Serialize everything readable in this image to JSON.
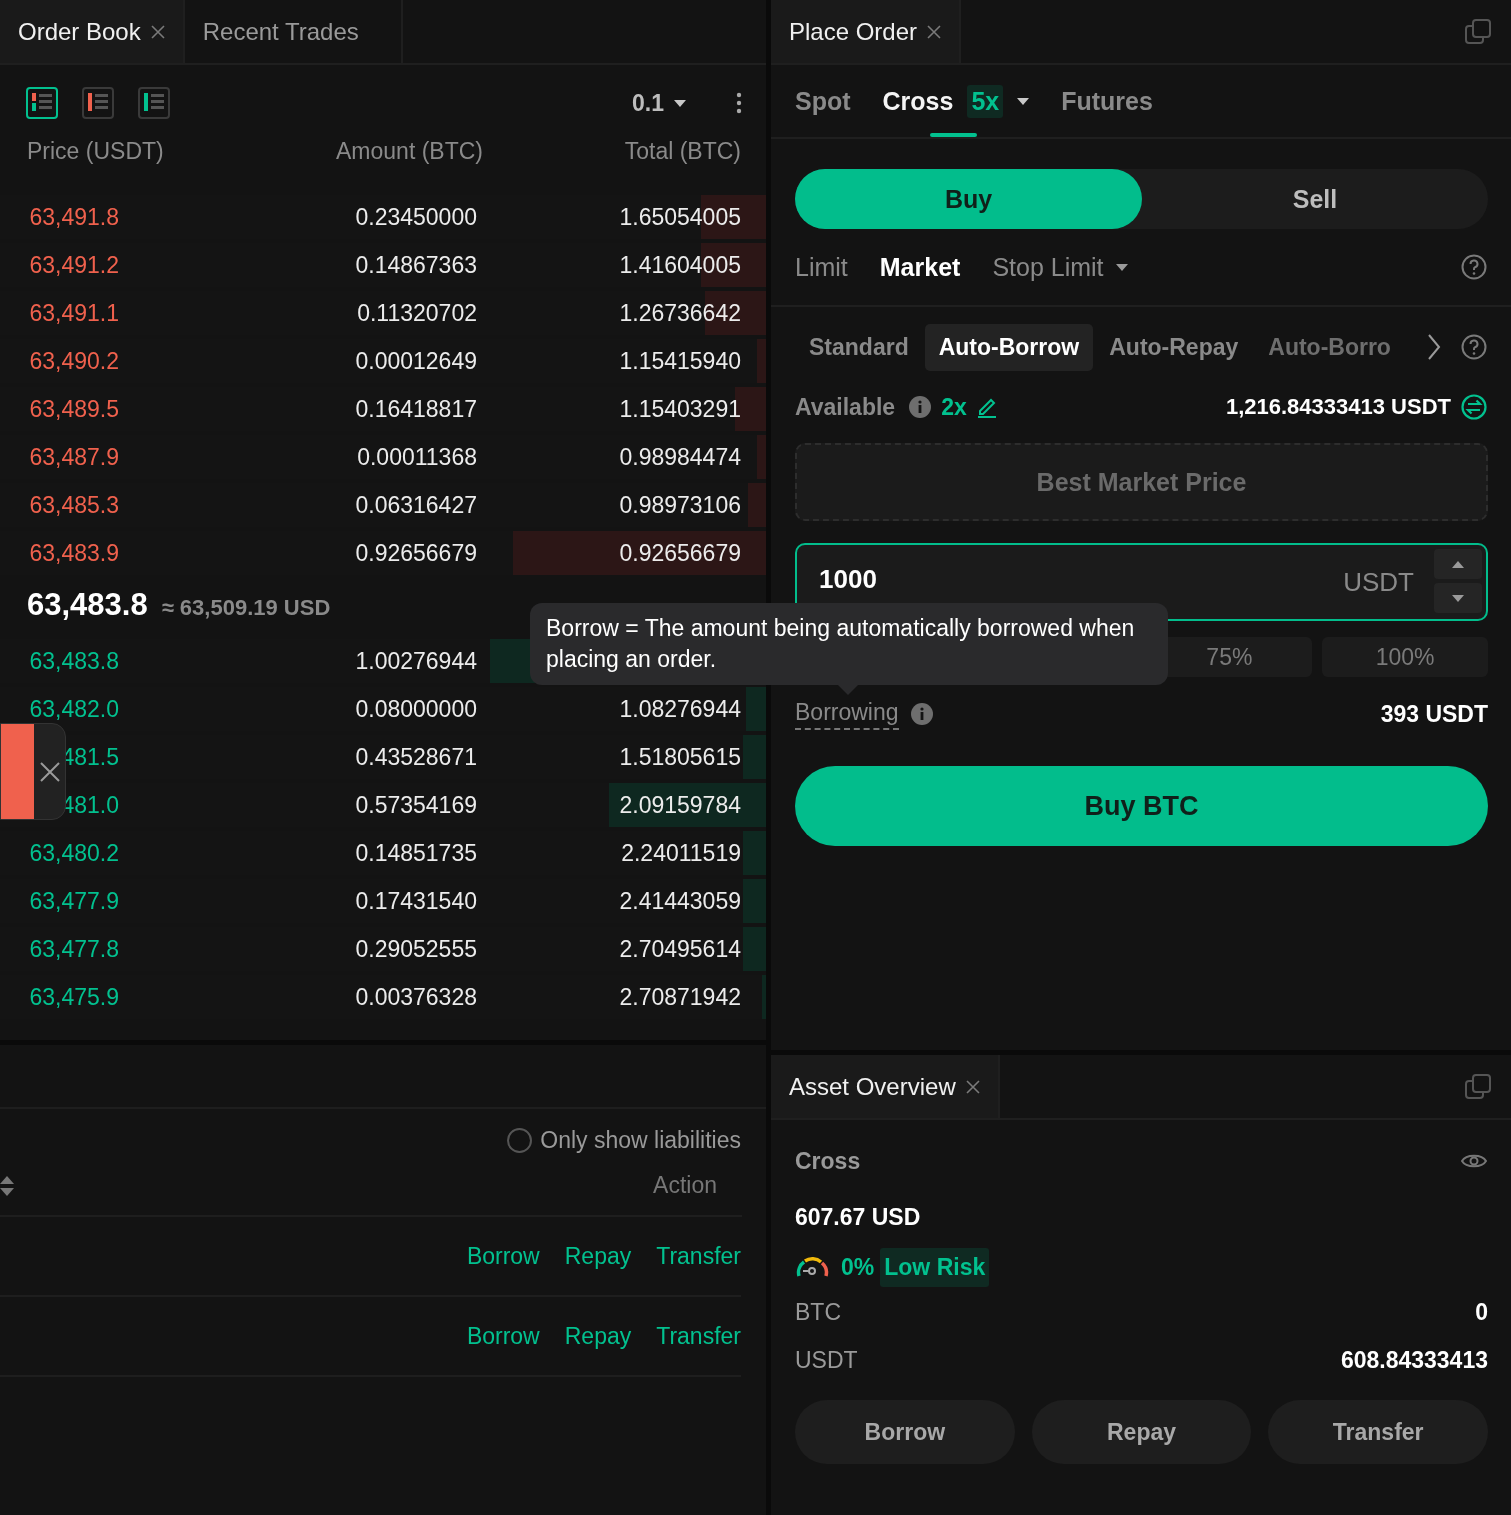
{
  "order_book": {
    "tabs": [
      {
        "label": "Order Book",
        "selected": true,
        "closable": true
      },
      {
        "label": "Recent Trades",
        "selected": false,
        "closable": false
      }
    ],
    "view_modes": [
      {
        "kind": "both",
        "selected": true
      },
      {
        "kind": "asks",
        "selected": false
      },
      {
        "kind": "bids",
        "selected": false
      }
    ],
    "precision": "0.1",
    "columns": [
      "Price (USDT)",
      "Amount (BTC)",
      "Total (BTC)"
    ],
    "asks": [
      {
        "price": "63,491.8",
        "amount": "0.23450000",
        "total": "1.65054005",
        "level": 0.085
      },
      {
        "price": "63,491.2",
        "amount": "0.14867363",
        "total": "1.41604005",
        "level": 0.085
      },
      {
        "price": "63,491.1",
        "amount": "0.11320702",
        "total": "1.26736642",
        "level": 0.08
      },
      {
        "price": "63,490.2",
        "amount": "0.00012649",
        "total": "1.15415940",
        "level": 0.012
      },
      {
        "price": "63,489.5",
        "amount": "0.16418817",
        "total": "1.15403291",
        "level": 0.04
      },
      {
        "price": "63,487.9",
        "amount": "0.00011368",
        "total": "0.98984474",
        "level": 0.012
      },
      {
        "price": "63,485.3",
        "amount": "0.06316427",
        "total": "0.98973106",
        "level": 0.024
      },
      {
        "price": "63,483.9",
        "amount": "0.92656679",
        "total": "0.92656679",
        "level": 0.33
      }
    ],
    "last_price": {
      "price": "63,483.8",
      "approx": "≈ 63,509.19 USD"
    },
    "bids": [
      {
        "price": "63,483.8",
        "amount": "1.00276944",
        "level": 0.36
      },
      {
        "price": "63,482.0",
        "amount": "0.08000000",
        "total": "1.08276944",
        "level": 0.026
      },
      {
        "price": "481.5",
        "amount": "0.43528671",
        "total": "1.51805615",
        "level": 0.03
      },
      {
        "price": "481.0",
        "amount": "0.57354169",
        "total": "2.09159784",
        "level": 0.205
      },
      {
        "price": "63,480.2",
        "amount": "0.14851735",
        "total": "2.24011519",
        "level": 0.03
      },
      {
        "price": "63,477.9",
        "amount": "0.17431540",
        "total": "2.41443059",
        "level": 0.03
      },
      {
        "price": "63,477.8",
        "amount": "0.29052555",
        "total": "2.70495614",
        "level": 0.03
      },
      {
        "price": "63,475.9",
        "amount": "0.00376328",
        "total": "2.70871942",
        "level": 0.005
      }
    ]
  },
  "positions": {
    "filter": {
      "label": "Only show liabilities",
      "checked": false
    },
    "action_header": "Action",
    "rows": [
      {
        "actions": [
          "Borrow",
          "Repay",
          "Transfer"
        ]
      },
      {
        "actions": [
          "Borrow",
          "Repay",
          "Transfer"
        ]
      }
    ]
  },
  "place_order": {
    "tabs": [
      {
        "label": "Place Order",
        "selected": true,
        "closable": true
      }
    ],
    "markets": [
      {
        "label": "Spot",
        "selected": false
      },
      {
        "label": "Cross",
        "selected": true,
        "badge": "5x",
        "dropdown": true
      },
      {
        "label": "Futures",
        "selected": false
      }
    ],
    "sides": [
      {
        "label": "Buy",
        "selected": true
      },
      {
        "label": "Sell",
        "selected": false
      }
    ],
    "order_types": [
      {
        "label": "Limit",
        "selected": false
      },
      {
        "label": "Market",
        "selected": true
      },
      {
        "label": "Stop Limit",
        "selected": false,
        "dropdown": true
      }
    ],
    "modes": [
      {
        "label": "Standard",
        "selected": false
      },
      {
        "label": "Auto-Borrow",
        "selected": true
      },
      {
        "label": "Auto-Repay",
        "selected": false
      },
      {
        "label": "Auto-Borro",
        "selected": false
      }
    ],
    "available": {
      "label": "Available",
      "leverage": "2x",
      "value": "1,216.84333413 USDT"
    },
    "price_field": {
      "placeholder": "Best Market Price",
      "disabled": true
    },
    "amount_field": {
      "value": "1000",
      "unit": "USDT"
    },
    "percentages": [
      "75%",
      "100%"
    ],
    "borrowing": {
      "label": "Borrowing",
      "value": "393 USDT"
    },
    "submit": "Buy BTC"
  },
  "tooltip": {
    "text": "Borrow = The amount being automatically borrowed when placing an order."
  },
  "asset_overview": {
    "tabs": [
      {
        "label": "Asset Overview",
        "selected": true,
        "closable": true
      }
    ],
    "account": "Cross",
    "total": "607.67 USD",
    "risk": {
      "ratio": "0%",
      "label": "Low Risk"
    },
    "balances": [
      {
        "asset": "BTC",
        "amount": "0"
      },
      {
        "asset": "USDT",
        "amount": "608.84333413"
      }
    ],
    "buttons": [
      "Borrow",
      "Repay",
      "Transfer"
    ]
  }
}
